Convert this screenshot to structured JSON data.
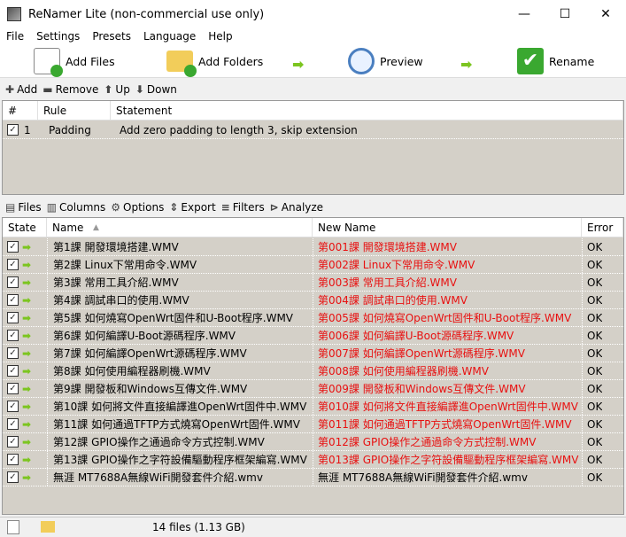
{
  "window": {
    "title": "ReNamer Lite (non-commercial use only)",
    "minimize": "—",
    "maximize": "☐",
    "close": "✕"
  },
  "menu": [
    "File",
    "Settings",
    "Presets",
    "Language",
    "Help"
  ],
  "toolbar": {
    "add_files": "Add Files",
    "add_folders": "Add Folders",
    "preview": "Preview",
    "rename": "Rename"
  },
  "rules_toolbar": {
    "add": "Add",
    "remove": "Remove",
    "up": "Up",
    "down": "Down"
  },
  "rules": {
    "headers": [
      "#",
      "Rule",
      "Statement"
    ],
    "rows": [
      {
        "num": "1",
        "rule": "Padding",
        "statement": "Add zero padding to length 3, skip extension",
        "checked": true
      }
    ]
  },
  "files_toolbar": {
    "files": "Files",
    "columns": "Columns",
    "options": "Options",
    "export": "Export",
    "filters": "Filters",
    "analyze": "Analyze"
  },
  "files": {
    "headers": {
      "state": "State",
      "name": "Name",
      "new_name": "New Name",
      "error": "Error"
    },
    "rows": [
      {
        "name": "第1課 開發環境搭建.WMV",
        "new": "第001課 開發環境搭建.WMV",
        "error": "OK",
        "changed": true
      },
      {
        "name": "第2課 Linux下常用命令.WMV",
        "new": "第002課 Linux下常用命令.WMV",
        "error": "OK",
        "changed": true
      },
      {
        "name": "第3課 常用工具介紹.WMV",
        "new": "第003課 常用工具介紹.WMV",
        "error": "OK",
        "changed": true
      },
      {
        "name": "第4課 調試串口的使用.WMV",
        "new": "第004課 調試串口的使用.WMV",
        "error": "OK",
        "changed": true
      },
      {
        "name": "第5課 如何燒寫OpenWrt固件和U-Boot程序.WMV",
        "new": "第005課 如何燒寫OpenWrt固件和U-Boot程序.WMV",
        "error": "OK",
        "changed": true
      },
      {
        "name": "第6課 如何編譯U-Boot源碼程序.WMV",
        "new": "第006課 如何編譯U-Boot源碼程序.WMV",
        "error": "OK",
        "changed": true
      },
      {
        "name": "第7課 如何編譯OpenWrt源碼程序.WMV",
        "new": "第007課 如何編譯OpenWrt源碼程序.WMV",
        "error": "OK",
        "changed": true
      },
      {
        "name": "第8課 如何使用編程器刷機.WMV",
        "new": "第008課 如何使用編程器刷機.WMV",
        "error": "OK",
        "changed": true
      },
      {
        "name": "第9課 開發板和Windows互傳文件.WMV",
        "new": "第009課 開發板和Windows互傳文件.WMV",
        "error": "OK",
        "changed": true
      },
      {
        "name": "第10課 如何將文件直接編譯進OpenWrt固件中.WMV",
        "new": "第010課 如何將文件直接編譯進OpenWrt固件中.WMV",
        "error": "OK",
        "changed": true
      },
      {
        "name": "第11課 如何通過TFTP方式燒寫OpenWrt固件.WMV",
        "new": "第011課 如何通過TFTP方式燒寫OpenWrt固件.WMV",
        "error": "OK",
        "changed": true
      },
      {
        "name": "第12課 GPIO操作之通過命令方式控制.WMV",
        "new": "第012課 GPIO操作之通過命令方式控制.WMV",
        "error": "OK",
        "changed": true
      },
      {
        "name": "第13課 GPIO操作之字符設備驅動程序框架編寫.WMV",
        "new": "第013課 GPIO操作之字符設備驅動程序框架編寫.WMV",
        "error": "OK",
        "changed": true
      },
      {
        "name": "無涯 MT7688A無線WiFi開發套件介紹.wmv",
        "new": "無涯 MT7688A無線WiFi開發套件介紹.wmv",
        "error": "OK",
        "changed": false
      }
    ]
  },
  "status": {
    "summary": "14 files (1.13 GB)"
  },
  "colors": {
    "changed": "#e81010",
    "grid_bg": "#d4d0c8",
    "arrow": "#7cc520"
  }
}
